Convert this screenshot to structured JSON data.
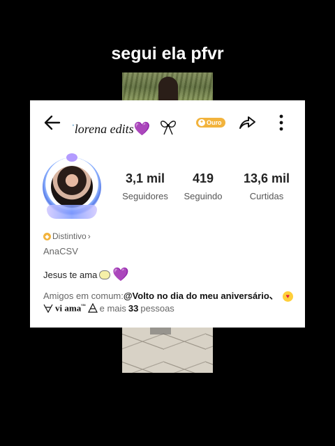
{
  "caption": "segui ela pfvr",
  "profile": {
    "username_prefix": "་",
    "username": "lorena edits",
    "username_heart": "💜",
    "badge_label": "Ouro",
    "stats": [
      {
        "value": "3,1 mil",
        "label": "Seguidores"
      },
      {
        "value": "419",
        "label": "Seguindo"
      },
      {
        "value": "13,6 mil",
        "label": "Curtidas"
      }
    ],
    "distintivo_label": "Distintivo",
    "distintivo_chevron": "›",
    "display_name": "AnaCSV",
    "bio_text": "Jesus te ama",
    "bio_heart": "💜",
    "mutual_prefix": "Amigos em comum:",
    "mutual_handle1": "@Volto no dia do meu aniversário、",
    "mutual_name2": "vi ama",
    "mutual_name2_suffix": "ᵛˣˢ",
    "mutual_more_prefix": "e mais",
    "mutual_more_count": "33",
    "mutual_more_suffix": "pessoas"
  },
  "colors": {
    "badge": "#f2b33c",
    "heart": "#7b2fbf"
  },
  "icons": [
    "back-arrow-icon",
    "bow-icon",
    "coin-icon",
    "share-icon",
    "more-vertical-icon",
    "badge-icon",
    "speech-bubble-icon",
    "heart-eyes-emoji-icon",
    "triangle-symbol-icon"
  ]
}
